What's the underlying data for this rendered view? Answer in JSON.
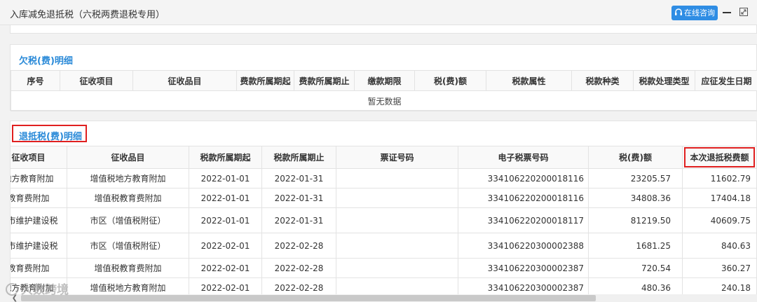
{
  "window": {
    "title": "入库减免退抵税（六税两费退税专用）",
    "online_button": "在线咨询",
    "icons": [
      "headset-icon",
      "minimize-icon",
      "maximize-icon"
    ]
  },
  "owed": {
    "title": "欠税(费)明细",
    "columns": [
      "序号",
      "征收项目",
      "征收品目",
      "费款所属期起",
      "费款所属期止",
      "缴款期限",
      "税(费)额",
      "税款属性",
      "税款种类",
      "税款处理类型",
      "应征发生日期"
    ],
    "empty_text": "暂无数据"
  },
  "refund": {
    "title": "退抵税(费)明细",
    "columns": [
      "征收项目",
      "征收品目",
      "税款所属期起",
      "税款所属期止",
      "票证号码",
      "电子税票号码",
      "税(费)额",
      "本次退抵税费额"
    ],
    "rows": [
      {
        "item": "地方教育附加",
        "subitem": "增值税地方教育附加",
        "start": "2022-01-01",
        "end": "2022-01-31",
        "ticket": "",
        "eticket": "334106220200018116",
        "amount": "23205.57",
        "refund": "11602.79"
      },
      {
        "item": "教育费附加",
        "subitem": "增值税教育费附加",
        "start": "2022-01-01",
        "end": "2022-01-31",
        "ticket": "",
        "eticket": "334106220200018116",
        "amount": "34808.36",
        "refund": "17404.18"
      },
      {
        "item": "城市维护建设税",
        "subitem": "市区（增值税附征）",
        "start": "2022-01-01",
        "end": "2022-01-31",
        "ticket": "",
        "eticket": "334106220200018117",
        "amount": "81219.50",
        "refund": "40609.75"
      },
      {
        "item": "城市维护建设税",
        "subitem": "市区（增值税附征）",
        "start": "2022-02-01",
        "end": "2022-02-28",
        "ticket": "",
        "eticket": "334106220300002388",
        "amount": "1681.25",
        "refund": "840.63"
      },
      {
        "item": "教育费附加",
        "subitem": "增值税教育费附加",
        "start": "2022-02-01",
        "end": "2022-02-28",
        "ticket": "",
        "eticket": "334106220300002387",
        "amount": "720.54",
        "refund": "360.27"
      },
      {
        "item": "地方教育附加",
        "subitem": "增值税地方教育附加",
        "start": "2022-02-01",
        "end": "2022-02-28",
        "ticket": "",
        "eticket": "334106220300002387",
        "amount": "480.36",
        "refund": "240.18"
      }
    ]
  },
  "watermark": "大数跨境",
  "colors": {
    "accent": "#2a8ad8",
    "button": "#2f8de4",
    "highlight": "#e02020"
  }
}
